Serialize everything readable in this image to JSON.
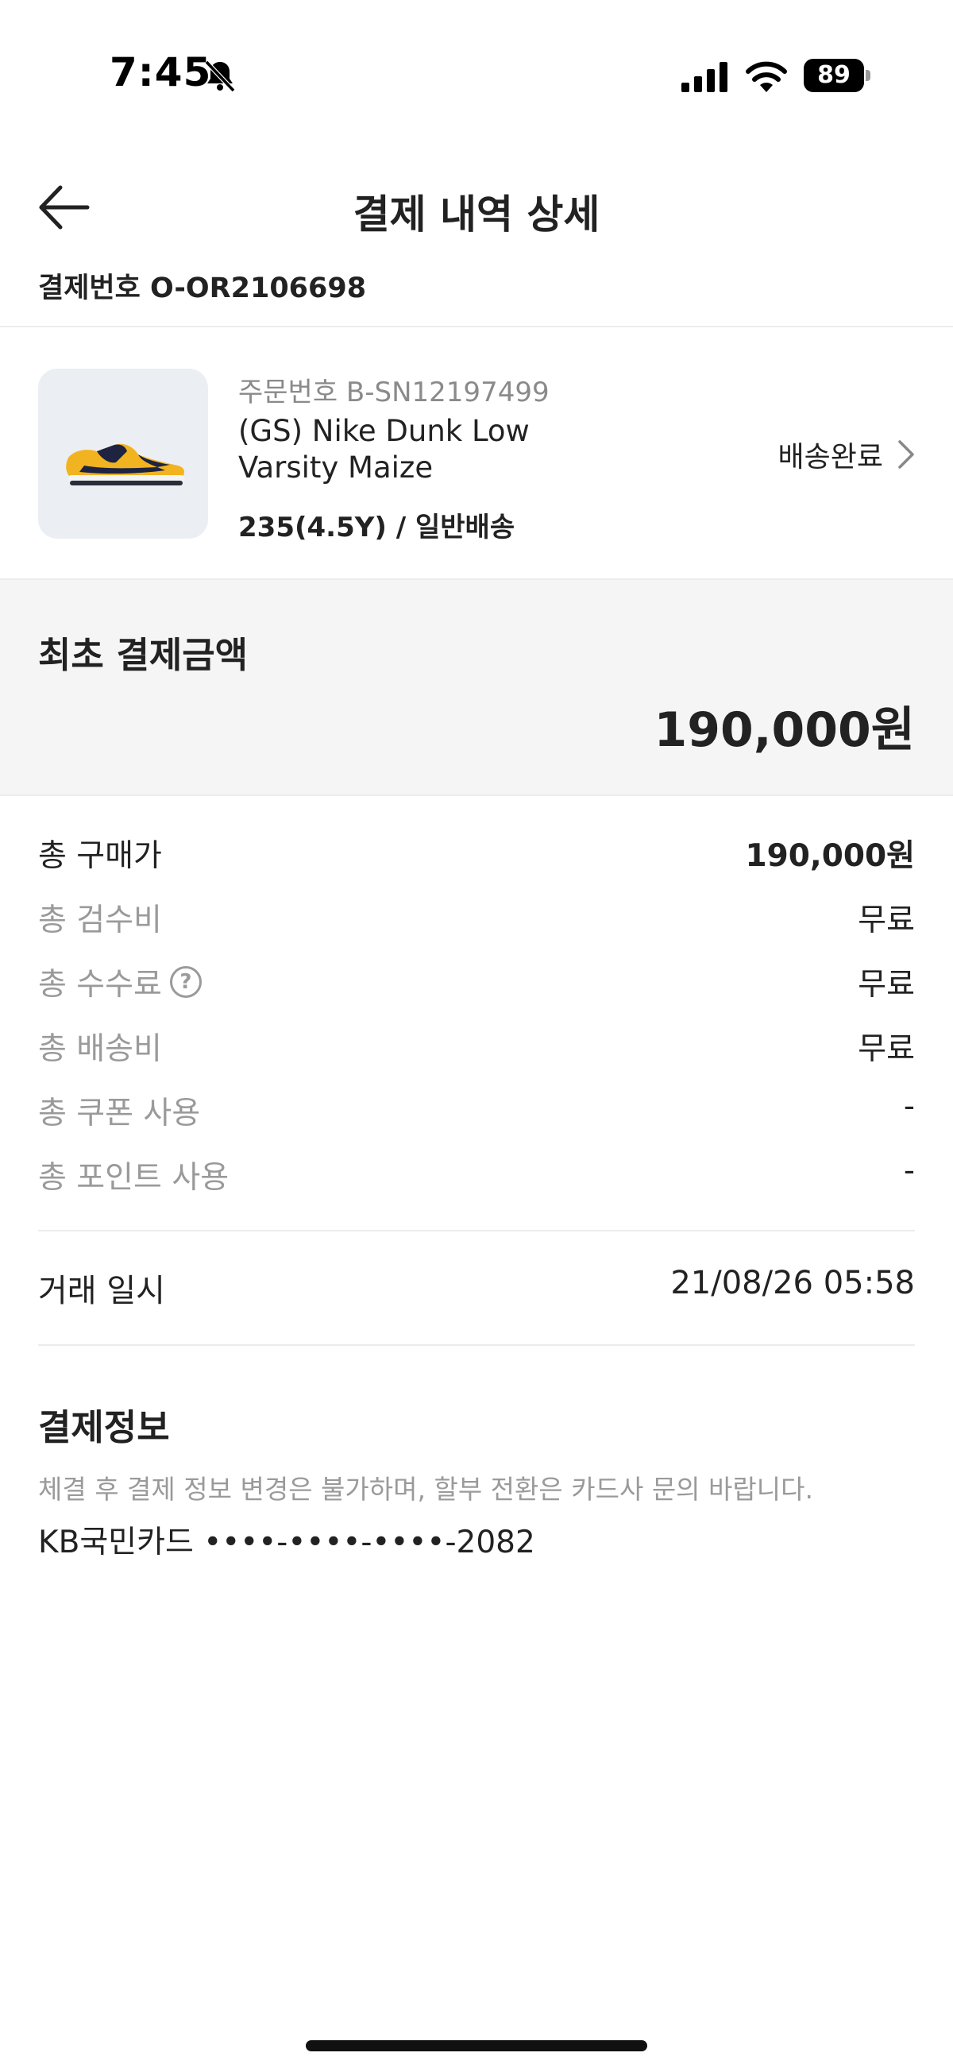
{
  "status_bar": {
    "time": "7:45",
    "battery": "89",
    "icons": [
      "bell-slash-icon",
      "cellular-signal-icon",
      "wifi-icon",
      "battery-icon"
    ]
  },
  "header": {
    "title": "결제 내역 상세",
    "back_icon": "arrow-left-icon"
  },
  "payment_number": "결제번호 O-OR2106698",
  "product": {
    "order_number": "주문번호 B-SN12197499",
    "name": "(GS) Nike Dunk Low Varsity Maize",
    "option": "235(4.5Y) / 일반배송",
    "status": "배송완료",
    "image_icon": "sneaker-image"
  },
  "initial_payment": {
    "label": "최초 결제금액",
    "amount": "190,000원"
  },
  "fees": [
    {
      "label": "총 구매가",
      "value": "190,000원"
    },
    {
      "label": "총 검수비",
      "value": "무료"
    },
    {
      "label": "총 수수료",
      "value": "무료",
      "help_icon": "?"
    },
    {
      "label": "총 배송비",
      "value": "무료"
    },
    {
      "label": "총 쿠폰 사용",
      "value": "-"
    },
    {
      "label": "총 포인트 사용",
      "value": "-"
    }
  ],
  "trade": {
    "label": "거래 일시",
    "value": "21/08/26 05:58"
  },
  "payment_info": {
    "title": "결제정보",
    "note": "체결 후 결제 정보 변경은 불가하며, 할부 전환은 카드사 문의 바랍니다.",
    "card": "KB국민카드 ••••-••••-••••-2082"
  },
  "colors": {
    "text_primary": "#222222",
    "text_secondary": "#9a9a9a",
    "summary_bg": "#f5f5f5",
    "thumb_bg": "#ebeff3",
    "divider": "#ececec"
  }
}
